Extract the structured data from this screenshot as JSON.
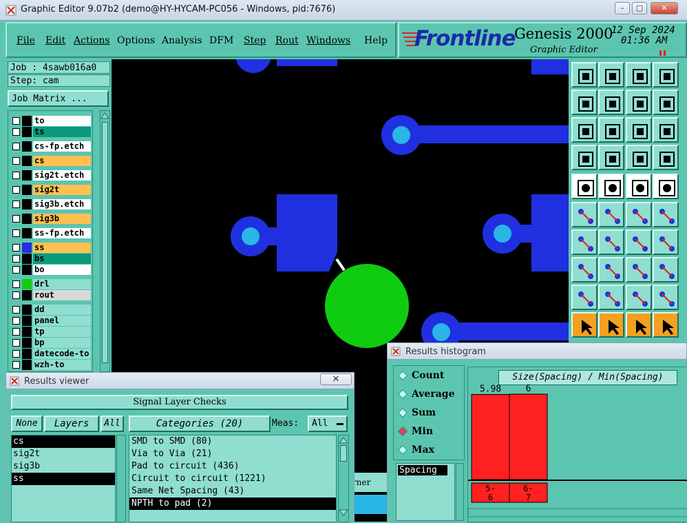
{
  "window": {
    "title": "Graphic Editor 9.07b2 (demo@HY-HYCAM-PC056 - Windows, pid:7676)"
  },
  "menu": {
    "items": [
      "File",
      "Edit",
      "Actions",
      "Options",
      "Analysis",
      "DFM",
      "Step",
      "Rout",
      "Windows",
      "Help"
    ]
  },
  "brand": {
    "logo": "Frontline",
    "product": "Genesis 2000",
    "subtitle": "Graphic Editor",
    "date": "12 Sep 2024",
    "time": "01:36 AM"
  },
  "job": {
    "job_label": "Job : 4sawb016a0",
    "step_label": "Step: cam",
    "matrix_button": "Job Matrix ..."
  },
  "layers": [
    {
      "name": "to",
      "color": "#ffffff"
    },
    {
      "name": "ts",
      "color": "#0a9a7a"
    },
    {
      "name": "cs-fp.etch",
      "color": "#ffffff"
    },
    {
      "name": "cs",
      "color": "#ffc050"
    },
    {
      "name": "sig2t.etch",
      "color": "#ffffff"
    },
    {
      "name": "sig2t",
      "color": "#ffc050"
    },
    {
      "name": "sig3b.etch",
      "color": "#ffffff"
    },
    {
      "name": "sig3b",
      "color": "#ffc050"
    },
    {
      "name": "ss-fp.etch",
      "color": "#ffffff"
    },
    {
      "name": "ss",
      "color": "#ffc050"
    },
    {
      "name": "bs",
      "color": "#0a9a7a"
    },
    {
      "name": "bo",
      "color": "#ffffff"
    },
    {
      "name": "drl",
      "color": "#8fded0"
    },
    {
      "name": "rout",
      "color": "#d8d8d8"
    },
    {
      "name": "dd",
      "color": "#8fded0"
    },
    {
      "name": "panel",
      "color": "#8fded0"
    },
    {
      "name": "tp",
      "color": "#8fded0"
    },
    {
      "name": "bp",
      "color": "#8fded0"
    },
    {
      "name": "datecode-to",
      "color": "#8fded0"
    },
    {
      "name": "wzh-to",
      "color": "#8fded0"
    }
  ],
  "results_viewer": {
    "title": "Results viewer",
    "header": "Signal Layer Checks",
    "none_btn": "None",
    "layers_btn": "Layers",
    "all_btn": "All",
    "categories_btn": "Categories (20)",
    "meas_label": "Meas:",
    "meas_value": "All",
    "layer_list": [
      "cs",
      "sig2t",
      "sig3b",
      "ss"
    ],
    "category_list": [
      "SMD to SMD (80)",
      "Via to Via (21)",
      "Pad to circuit (436)",
      "Circuit to circuit (1221)",
      "Same Net Spacing (43)",
      "NPTH to pad (2)"
    ],
    "partial_text": "rner"
  },
  "histogram": {
    "title": "Results histogram",
    "options": [
      "Count",
      "Average",
      "Sum",
      "Min",
      "Max"
    ],
    "selected": "Min",
    "measure": "Spacing",
    "chart_title": "Size(Spacing) / Min(Spacing)"
  },
  "chart_data": {
    "type": "bar",
    "title": "Size(Spacing) / Min(Spacing)",
    "categories": [
      "5-6",
      "6-7"
    ],
    "values": [
      5.98,
      6
    ],
    "value_labels": [
      "5.98",
      "6"
    ],
    "bar_color": "#ff2020"
  }
}
